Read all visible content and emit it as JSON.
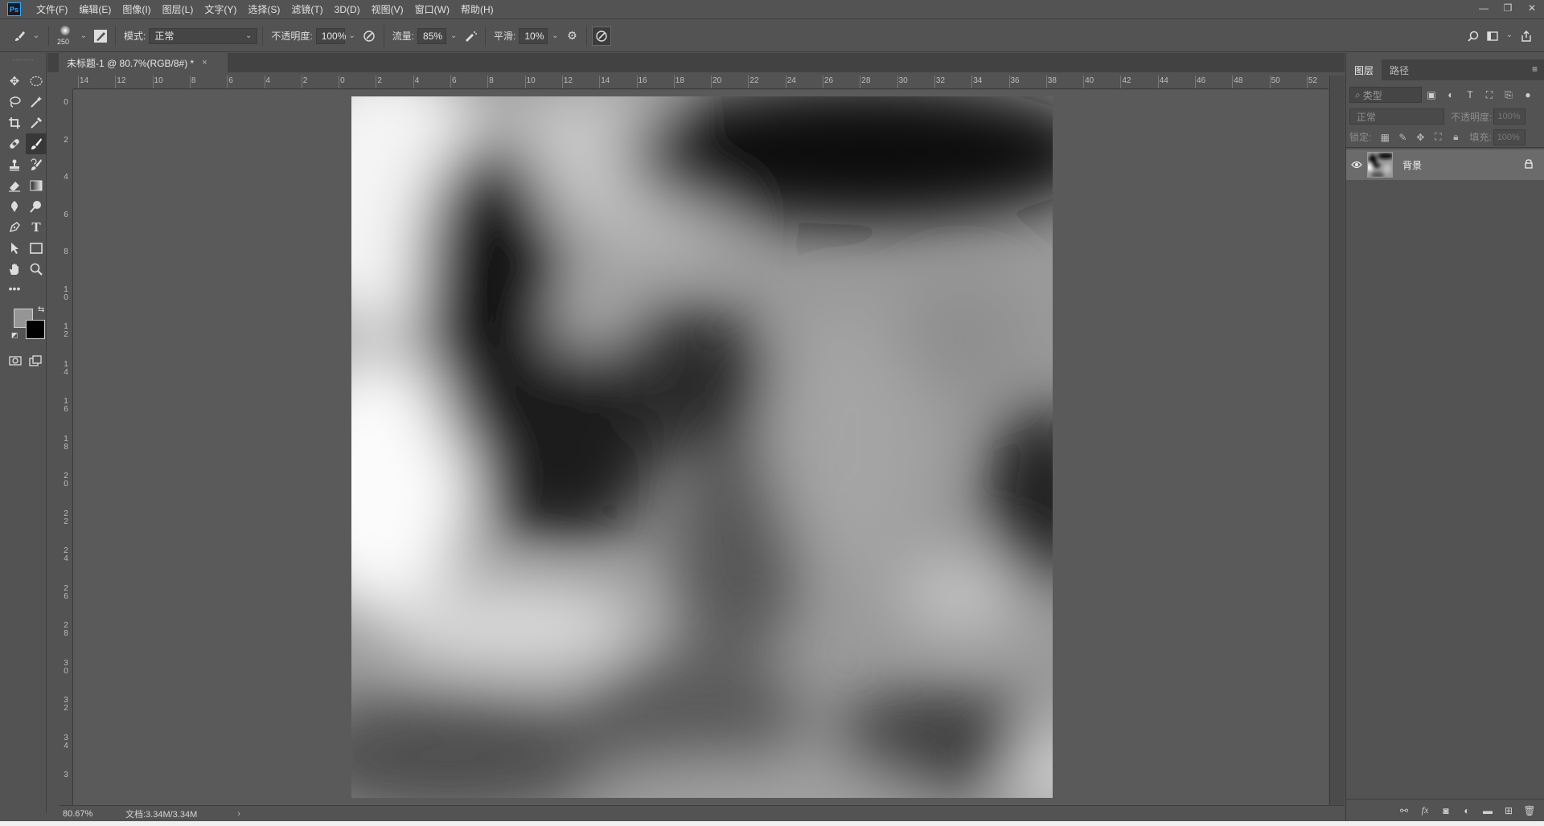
{
  "app": {
    "logo": "Ps"
  },
  "menu": [
    "文件(F)",
    "编辑(E)",
    "图像(I)",
    "图层(L)",
    "文字(Y)",
    "选择(S)",
    "滤镜(T)",
    "3D(D)",
    "视图(V)",
    "窗口(W)",
    "帮助(H)"
  ],
  "window_controls": {
    "minimize": "—",
    "restore": "❐",
    "close": "✕"
  },
  "options": {
    "brush_size": "250",
    "mode_label": "模式:",
    "mode_value": "正常",
    "opacity_label": "不透明度:",
    "opacity_value": "100%",
    "flow_label": "流量:",
    "flow_value": "85%",
    "smooth_label": "平滑:",
    "smooth_value": "10%"
  },
  "document": {
    "tab_title": "未标题-1 @ 80.7%(RGB/8#) *",
    "close": "×"
  },
  "ruler_top": [
    "14",
    "12",
    "10",
    "8",
    "6",
    "4",
    "2",
    "0",
    "2",
    "4",
    "6",
    "8",
    "10",
    "12",
    "14",
    "16",
    "18",
    "20",
    "22",
    "24",
    "26",
    "28",
    "30",
    "32",
    "34",
    "36",
    "38",
    "40",
    "42",
    "44",
    "46",
    "48",
    "50",
    "52"
  ],
  "ruler_left": [
    "0",
    "2",
    "4",
    "6",
    "8",
    "1\n0",
    "1\n2",
    "1\n4",
    "1\n6",
    "1\n8",
    "2\n0",
    "2\n2",
    "2\n4",
    "2\n6",
    "2\n8",
    "3\n0",
    "3\n2",
    "3\n4",
    "3"
  ],
  "status": {
    "zoom": "80.67%",
    "doc_info": "文档:3.34M/3.34M",
    "arrow": "›"
  },
  "layers_panel": {
    "tabs": [
      "图层",
      "路径"
    ],
    "filter_placeholder": "类型",
    "blend_mode": "正常",
    "opacity_label": "不透明度:",
    "opacity_value": "100%",
    "lock_label": "锁定:",
    "fill_label": "填充:",
    "fill_value": "100%",
    "layers": [
      {
        "name": "背景",
        "visible": true,
        "locked": true
      }
    ]
  },
  "colors": {
    "foreground": "#959595",
    "background": "#000000",
    "accent": "#31a8ff"
  }
}
